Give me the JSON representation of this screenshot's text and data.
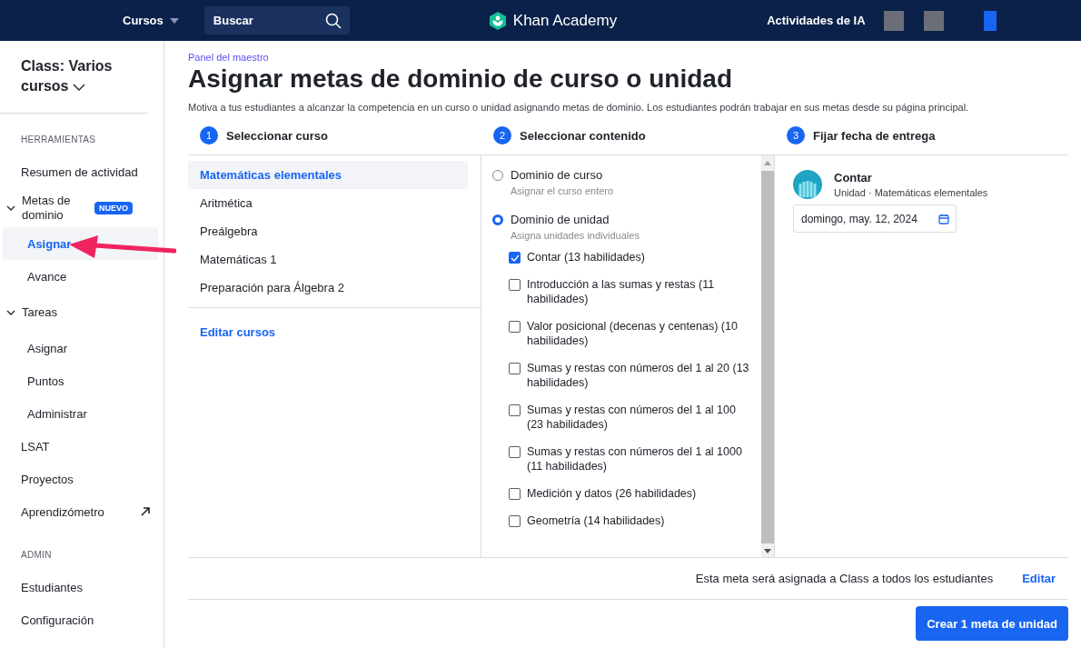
{
  "top_bar": {
    "courses_menu": "Cursos",
    "search": {
      "placeholder": "Buscar"
    },
    "logo": "Khan Academy",
    "ai_activities": "Actividades de IA"
  },
  "sidebar": {
    "class_selector": "Class: Varios cursos",
    "sections": [
      {
        "heading": "HERRAMIENTAS",
        "items": [
          {
            "label": "Resumen de actividad",
            "selected": false
          },
          {
            "label": "Metas de dominio",
            "selected": false,
            "badge": "NUEVO",
            "expanded": true,
            "children": [
              {
                "label": "Asignar",
                "selected": true
              },
              {
                "label": "Avance",
                "selected": false
              }
            ]
          },
          {
            "label": "Tareas",
            "selected": false,
            "expanded": true,
            "children": [
              {
                "label": "Asignar",
                "selected": false
              },
              {
                "label": "Puntos",
                "selected": false
              },
              {
                "label": "Administrar",
                "selected": false
              }
            ]
          },
          {
            "label": "LSAT",
            "selected": false
          },
          {
            "label": "Proyectos",
            "selected": false
          },
          {
            "label": "Aprendizómetro",
            "selected": false,
            "external": true
          }
        ]
      },
      {
        "heading": "ADMIN",
        "items": [
          {
            "label": "Estudiantes",
            "selected": false
          },
          {
            "label": "Configuración",
            "selected": false
          }
        ]
      }
    ]
  },
  "main": {
    "breadcrumb": "Panel del maestro",
    "title": "Asignar metas de dominio de curso o unidad",
    "description": "Motiva a tus estudiantes a alcanzar la competencia en un curso o unidad asignando metas de dominio. Los estudiantes podrán trabajar en sus metas desde su página principal.",
    "steps": [
      {
        "number": "1",
        "title": "Seleccionar curso"
      },
      {
        "number": "2",
        "title": "Seleccionar contenido"
      },
      {
        "number": "3",
        "title": "Fijar fecha de entrega"
      }
    ],
    "courses": [
      {
        "label": "Matemáticas elementales",
        "selected": true
      },
      {
        "label": "Aritmética",
        "selected": false
      },
      {
        "label": "Preálgebra",
        "selected": false
      },
      {
        "label": "Matemáticas 1",
        "selected": false
      },
      {
        "label": "Preparación para Álgebra 2",
        "selected": false
      }
    ],
    "edit_courses_link": "Editar cursos",
    "mastery_options": [
      {
        "label": "Dominio de curso",
        "sublabel": "Asignar el curso entero",
        "selected": false
      },
      {
        "label": "Dominio de unidad",
        "sublabel": "Asigna unidades individuales",
        "selected": true
      }
    ],
    "units": [
      {
        "label": "Contar (13 habilidades)",
        "checked": true
      },
      {
        "label": "Introducción a las sumas y restas (11 habilidades)",
        "checked": false
      },
      {
        "label": "Valor posicional (decenas y centenas) (10 habilidades)",
        "checked": false
      },
      {
        "label": "Sumas y restas con números del 1 al 20 (13 habilidades)",
        "checked": false
      },
      {
        "label": "Sumas y restas con números del 1 al 100 (23 habilidades)",
        "checked": false
      },
      {
        "label": "Sumas y restas con números del 1 al 1000 (11 habilidades)",
        "checked": false
      },
      {
        "label": "Medición y datos (26 habilidades)",
        "checked": false
      },
      {
        "label": "Geometría (14 habilidades)",
        "checked": false
      }
    ],
    "due": {
      "unit_title": "Contar",
      "unit_subtitle": "Unidad · Matemáticas elementales",
      "date": "domingo, may. 12, 2024"
    },
    "footer": {
      "assignment_note": "Esta meta será asignada a Class a todos los estudiantes",
      "edit_link": "Editar",
      "create_button": "Crear 1 meta de unidad"
    }
  }
}
